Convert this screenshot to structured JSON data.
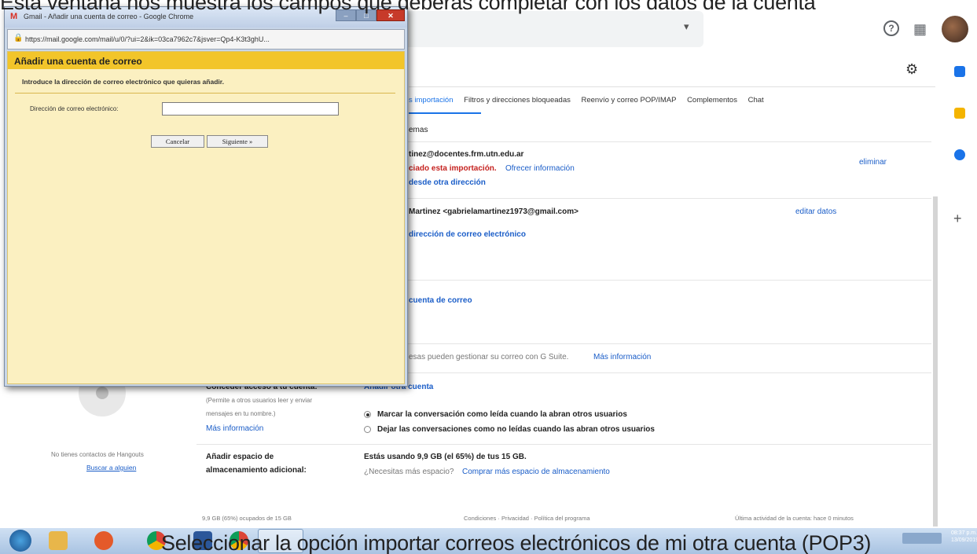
{
  "captions": {
    "top": "Esta ventana nos muestra los campos que deberas completar con los datos de la cuenta",
    "bottom": "Seleccionar la opción importar correos electrónicos de mi otra cuenta (POP3)"
  },
  "popup": {
    "window_title": "Gmail - Añadir una cuenta de correo - Google Chrome",
    "url": "https://mail.google.com/mail/u/0/?ui=2&ik=03ca7962c7&jsver=Qp4-K3t3ghU...",
    "heading": "Añadir una cuenta de correo",
    "subtitle": "Introduce la dirección de correo electrónico que quieras añadir.",
    "field_label": "Dirección de correo electrónico:",
    "field_value": "",
    "cancel_label": "Cancelar",
    "next_label": "Siguiente »",
    "close_label": "✕"
  },
  "tabs": [
    "s importación",
    "Filtros y direcciones bloqueadas",
    "Reenvío y correo POP/IMAP",
    "Complementos",
    "Chat"
  ],
  "settings": {
    "rows_intro": "emas",
    "import_email": "tinez@docentes.frm.utn.edu.ar",
    "import_status": "ciado esta importación.",
    "import_more_info": "Ofrecer información",
    "import_delete": "eliminar",
    "import_other": "desde otra dirección",
    "sendas_name": "Martinez <gabrielamartinez1973@gmail.com>",
    "sendas_edit": "editar datos",
    "sendas_add": "dirección de correo electrónico",
    "add_account": "cuenta de correo",
    "gsuite_text": "esas pueden gestionar su correo con G Suite.",
    "gsuite_link": "Más información",
    "grant_title": "Conceder acceso a tu cuenta:",
    "grant_add": "Añadir otra cuenta",
    "grant_desc1": "(Permite a otros usuarios leer y enviar",
    "grant_desc2": "mensajes en tu nombre.)",
    "grant_more": "Más información",
    "radio1": "Marcar la conversación como leída cuando la abran otros usuarios",
    "radio2": "Dejar las conversaciones como no leídas cuando las abran otros usuarios",
    "storage_title1": "Añadir espacio de",
    "storage_title2": "almacenamiento adicional:",
    "storage_usage": "Estás usando 9,9 GB (el 65%) de tus 15 GB.",
    "storage_question": "¿Necesitas más espacio?",
    "storage_buy": "Comprar más espacio de almacenamiento",
    "hangouts_empty": "No tienes contactos de Hangouts",
    "hangouts_find": "Buscar a alguien",
    "footer_usage": "9,9 GB (65%) ocupados de 15 GB",
    "footer_links": "Condiciones · Privacidad · Política del programa",
    "footer_activity": "Última actividad de la cuenta: hace 0 minutos"
  },
  "taskbar": {
    "time": "08:37 p.m.",
    "date": "13/09/2019"
  },
  "colors": {
    "popup_header": "#f2c52a",
    "popup_body": "#fbf0c1",
    "link": "#1a5dc8",
    "warning": "#c5221f"
  }
}
